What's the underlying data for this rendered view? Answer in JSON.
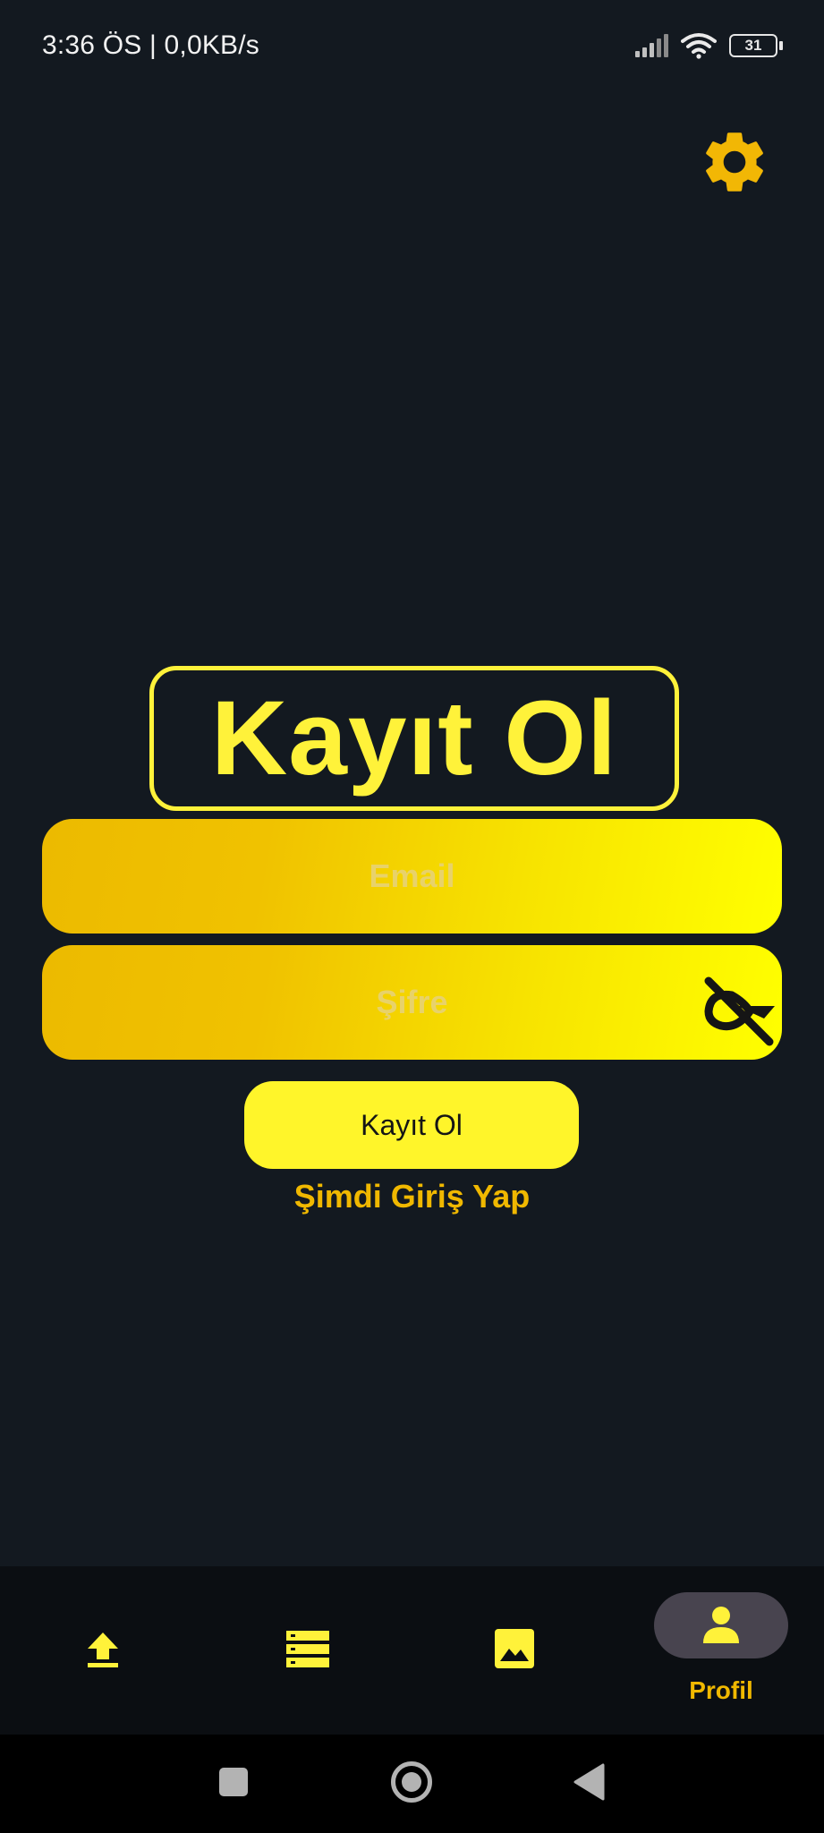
{
  "status_bar": {
    "time_network": "3:36 ÖS | 0,0KB/s",
    "battery": "31"
  },
  "settings": {
    "icon": "gear-icon",
    "color": "#F2B705"
  },
  "form": {
    "title": "Kayıt Ol",
    "email_placeholder": "Email",
    "password_placeholder": "Şifre",
    "visibility_icon": "visibility-off-icon",
    "submit_label": "Kayıt Ol",
    "login_link": "Şimdi Giriş Yap"
  },
  "bottom_nav": {
    "items": [
      {
        "icon": "upload-icon",
        "label": ""
      },
      {
        "icon": "list-icon",
        "label": ""
      },
      {
        "icon": "image-icon",
        "label": ""
      },
      {
        "icon": "person-icon",
        "label": "Profil",
        "selected": true
      }
    ]
  },
  "system_nav": [
    "recents-icon",
    "home-icon",
    "back-icon"
  ],
  "colors": {
    "background": "#131920",
    "accent": "#FFF23A",
    "accent_dark": "#F0B800",
    "nav_background": "#0B0E12"
  }
}
